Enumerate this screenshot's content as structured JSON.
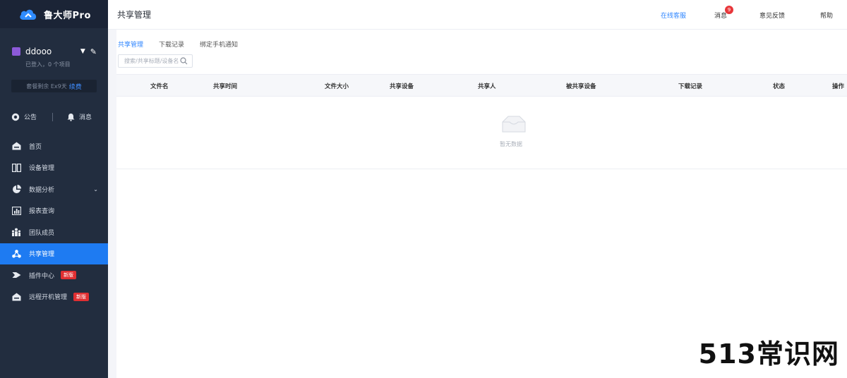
{
  "app": {
    "title": "鲁大师Pro"
  },
  "user": {
    "name": "ddooo",
    "subtitle": "已登入，0 个项目"
  },
  "account": {
    "label": "套餐剩余 Ex9天",
    "link": "续费"
  },
  "quick": {
    "notice": "公告",
    "message": "消息"
  },
  "sidebar": {
    "items": [
      {
        "label": "首页",
        "icon": "home-icon"
      },
      {
        "label": "设备管理",
        "icon": "device-icon"
      },
      {
        "label": "数据分析",
        "icon": "pie-chart-icon",
        "has_chevron": true
      },
      {
        "label": "报表查询",
        "icon": "bar-chart-icon"
      },
      {
        "label": "团队成员",
        "icon": "team-icon"
      },
      {
        "label": "共享管理",
        "icon": "share-icon",
        "active": true
      },
      {
        "label": "插件中心",
        "icon": "plugin-icon",
        "tag": "新版"
      },
      {
        "label": "远程开机管理",
        "icon": "power-icon",
        "tag": "新版"
      }
    ]
  },
  "header": {
    "title": "共享管理",
    "link": "在线客服",
    "bell": "消息",
    "bell_count": "9",
    "feedback": "意见反馈",
    "help": "帮助"
  },
  "tabs": [
    "共享管理",
    "下载记录",
    "绑定手机通知"
  ],
  "search": {
    "placeholder": "搜索/共享标题/设备名"
  },
  "table": {
    "columns": [
      "文件名",
      "共享时间",
      "文件大小",
      "共享设备",
      "共享人",
      "被共享设备",
      "下载记录",
      "状态",
      "操作"
    ],
    "empty_text": "暂无数据"
  },
  "watermark": "513常识网",
  "colors": {
    "sidebar": "#222d3f",
    "active": "#1e7bf2",
    "accent": "#2f86ff",
    "tag": "#e02f32"
  }
}
